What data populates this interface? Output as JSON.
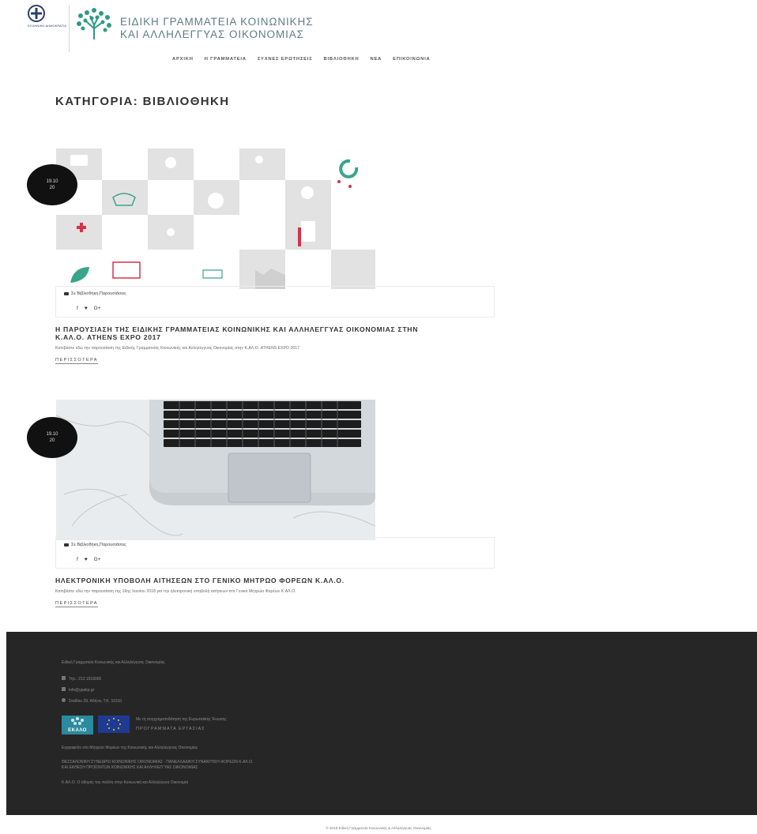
{
  "header": {
    "brand_line1": "ΕΙΔΙΚΗ ΓΡΑΜΜΑΤΕΙΑ ΚΟΙΝΩΝΙΚΗΣ",
    "brand_line2": "ΚΑΙ ΑΛΛΗΛΕΓΓΥΑΣ ΟΙΚΟΝΟΜΙΑΣ",
    "gov_logo_text": "ΕΛΛΗΝΙΚΗ ΔΗΜΟΚΡΑΤΙΑ",
    "nav": [
      "ΑΡΧΙΚΗ",
      "Η ΓΡΑΜΜΑΤΕΙΑ",
      "ΣΥΧΝΕΣ ΕΡΩΤΗΣΕΙΣ",
      "ΒΙΒΛΙΟΘΗΚΗ",
      "ΝΕΑ",
      "ΕΠΙΚΟΙΝΩΝΙΑ"
    ]
  },
  "page_title": "ΚΑΤΗΓΟΡΙΑ: ΒΙΒΛΙΟΘΗΚΗ",
  "posts": [
    {
      "date": "19.10",
      "year": "20",
      "category": "Σε Βιβλιοθήκη,Παρουσιάσεις",
      "share": [
        "f",
        "♥",
        "G+"
      ],
      "title_line1": "Η ΠΑΡΟΥΣΙΑΣΗ ΤΗΣ ΕΙΔΙΚΗΣ ΓΡΑΜΜΑΤΕΙΑΣ ΚΟΙΝΩΝΙΚΗΣ ΚΑΙ ΑΛΛΗΛΕΓΓΥΑΣ ΟΙΚΟΝΟΜΙΑΣ ΣΤΗΝ",
      "title_line2": "Κ.ΑΛ.Ο. ATHENS EXPO 2017",
      "excerpt": "Κατεβάστε εδώ την παρουσίαση της Ειδικής Γραμματείας Κοινωνικής και Αλληλέγγυας Οικονομίας στην Κ.ΑΛ.Ο. ATHENS EXPO 2017",
      "more": "ΠΕΡΙΣΣΟΤΕΡΑ"
    },
    {
      "date": "19.10",
      "year": "20",
      "category": "Σε Βιβλιοθήκη,Παρουσιάσεις",
      "share": [
        "f",
        "♥",
        "G+"
      ],
      "title_line1": "ΗΛΕΚΤΡΟΝΙΚΗ ΥΠΟΒΟΛΗ ΑΙΤΗΣΕΩΝ ΣΤΟ ΓΕΝΙΚΟ ΜΗΤΡΩΟ ΦΟΡΕΩΝ Κ.ΑΛ.Ο.",
      "title_line2": "",
      "excerpt": "Κατεβάστε εδώ την παρουσίαση της 16ης Ιουνίου 2018 για την ηλεκτρονική υποβολή αιτήσεων στο Γενικό Μητρώο Φορέων Κ.ΑΛ.Ο.",
      "more": "ΠΕΡΙΣΣΟΤΕΡΑ"
    }
  ],
  "footer": {
    "heading": "Ειδική Γραμματεία Κοινωνικής και Αλληλέγγυας Οικονομίας",
    "phone": "Τηλ.: 213 1516000",
    "email": "info@ypakp.gr",
    "address": "Σταδίου 29, Αθήνα, Τ.Κ. 10110",
    "eu_text_line1": "Με τη συγχρηματοδότηση της Ευρωπαϊκής Ένωσης",
    "eu_text_line2": "ΠΡΟΓΡΑΜΜΑΤΑ ΕΡΓΑΣΙΑΣ",
    "ekalo_label": "ΕΚΑΛΟ",
    "line1": "Εγγραφείτε στο Μητρώο Φορέων της Κοινωνικής και Αλληλέγγυας Οικονομίας",
    "line2a": "ΘΕΣΣΑΛΟΝΙΚΗ ΣΥΝΕΔΡΙΟ ΚΟΙΝΩΝΙΚΗΣ ΟΙΚΟΝΟΜΙΑΣ - ΠΑΝΕΛΛΑΔΙΚΗ ΣΥΝΑΝΤΗΣΗ ΦΟΡΕΩΝ Κ.ΑΛ.Ο.",
    "line2b": "ΚΑΙ ΕΚΘΕΣΗ ΠΡΟΪΟΝΤΩΝ ΚΟΙΝΩΝΙΚΗΣ ΚΑΙ ΑΛΛΗΛΕΓΓΥΑΣ ΟΙΚΟΝΟΜΙΑΣ",
    "line3": "Κ.ΑΛ.Ο. Ο οδηγός του πολίτη στην Κοινωνική και Αλληλέγγυα Οικονομία"
  },
  "copyright": "© 2018 Ειδική Γραμματεία Κοινωνικής & Αλληλέγγυας Οικονομίας",
  "colors": {
    "footer_bg": "#262626",
    "brand_text": "#5f7d86",
    "accent_green": "#3aa58a",
    "accent_red": "#d6334a"
  }
}
